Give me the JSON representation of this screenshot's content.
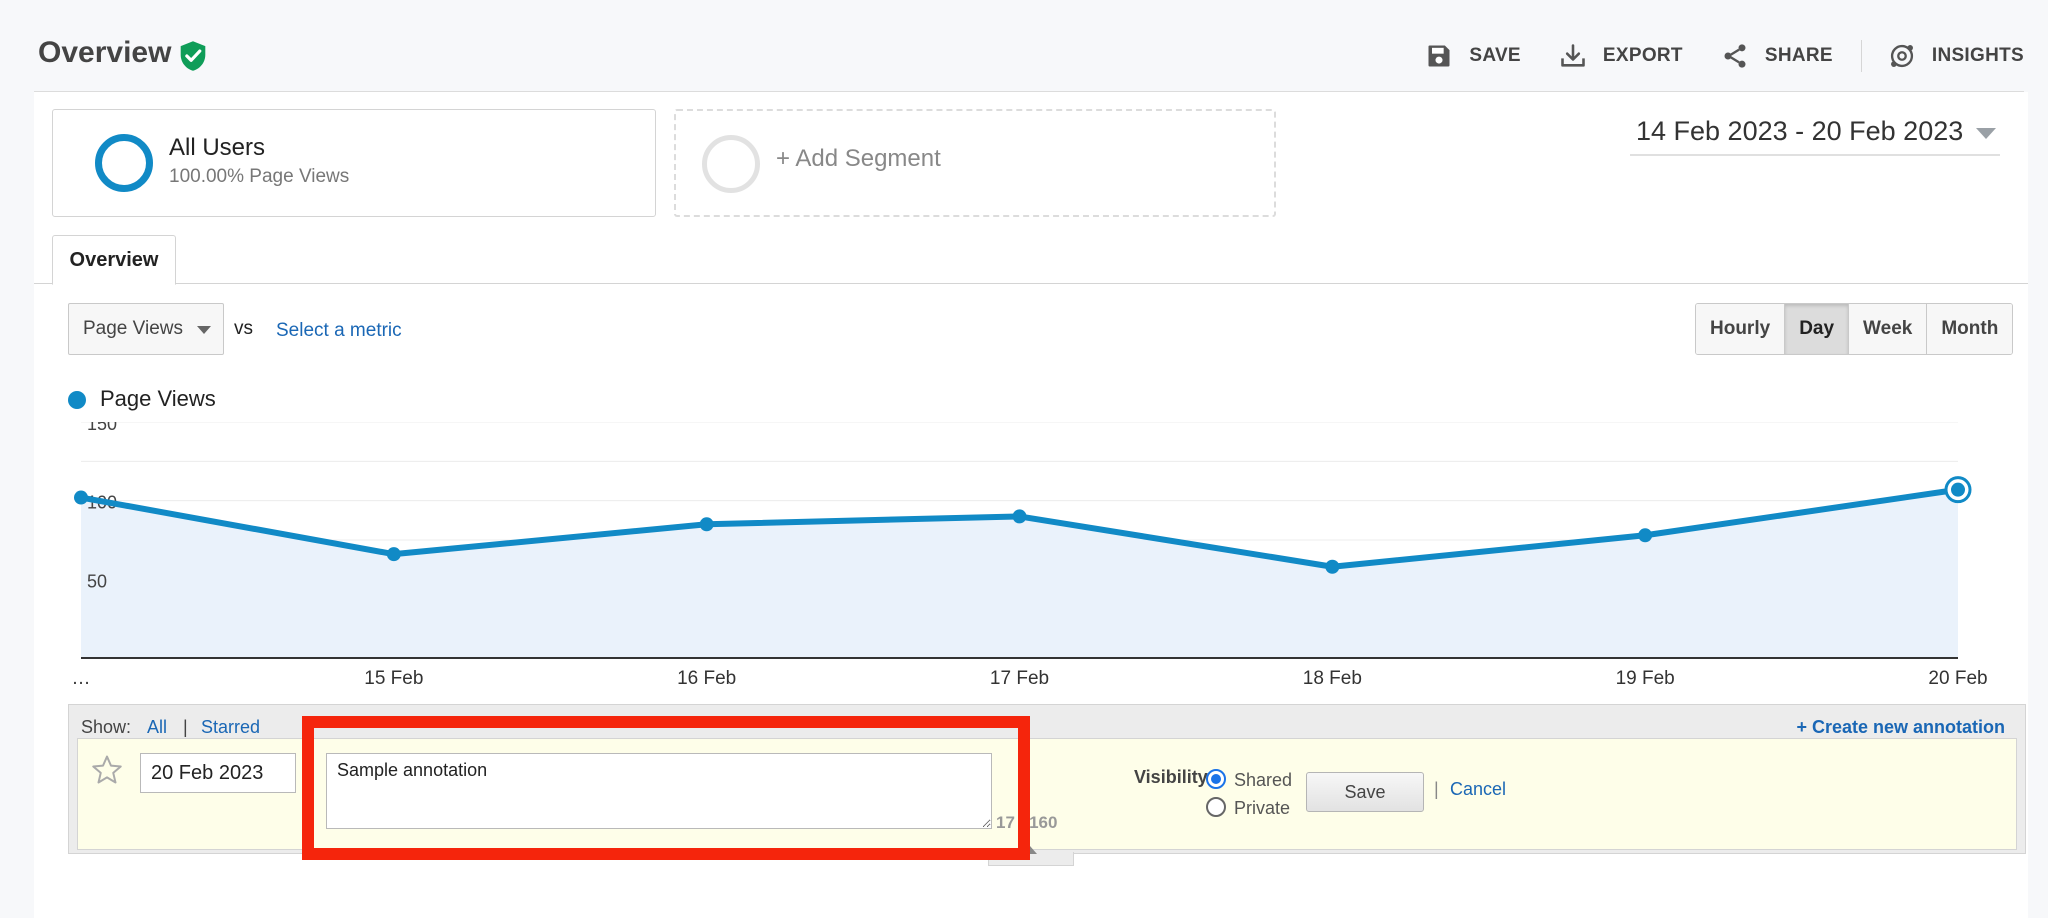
{
  "header": {
    "title": "Overview",
    "toolbar": {
      "save_label": "SAVE",
      "export_label": "EXPORT",
      "share_label": "SHARE",
      "insights_label": "INSIGHTS"
    }
  },
  "segments": {
    "active": {
      "name": "All Users",
      "detail": "100.00% Page Views"
    },
    "add_label": "+ Add Segment"
  },
  "date_range": "14 Feb 2023 - 20 Feb 2023",
  "tabs": [
    {
      "label": "Overview"
    }
  ],
  "metric": {
    "selected": "Page Views",
    "vs_label": "vs",
    "select_metric_label": "Select a metric"
  },
  "period": {
    "options": [
      "Hourly",
      "Day",
      "Week",
      "Month"
    ],
    "active": "Day"
  },
  "chart_data": {
    "type": "area",
    "series": [
      {
        "name": "Page Views",
        "color": "#118ac6",
        "values": [
          102,
          66,
          85,
          90,
          58,
          78,
          107
        ]
      }
    ],
    "x": [
      "14 Feb",
      "15 Feb",
      "16 Feb",
      "17 Feb",
      "18 Feb",
      "19 Feb",
      "20 Feb"
    ],
    "x_tick_labels": [
      "…",
      "15 Feb",
      "16 Feb",
      "17 Feb",
      "18 Feb",
      "19 Feb",
      "20 Feb"
    ],
    "y_ticks": [
      50,
      100,
      150
    ],
    "ylim": [
      0,
      150
    ],
    "grid": true,
    "legend": "top-left",
    "fill_color": "#eaf2fb"
  },
  "annotations": {
    "show_label": "Show:",
    "show_all": "All",
    "show_separator": "|",
    "show_starred": "Starred",
    "create_label": "+ Create new annotation",
    "form": {
      "date": "20 Feb 2023",
      "text": "Sample annotation",
      "char_count": "17 / 160",
      "visibility_label": "Visibility:",
      "option_shared": "Shared",
      "option_private": "Private",
      "selected_visibility": "Shared",
      "save_label": "Save",
      "separator": "|",
      "cancel_label": "Cancel"
    }
  },
  "colors": {
    "accent": "#118ac6",
    "link": "#1a67b5",
    "verified": "#0f9d58",
    "highlight": "#f5250c"
  }
}
